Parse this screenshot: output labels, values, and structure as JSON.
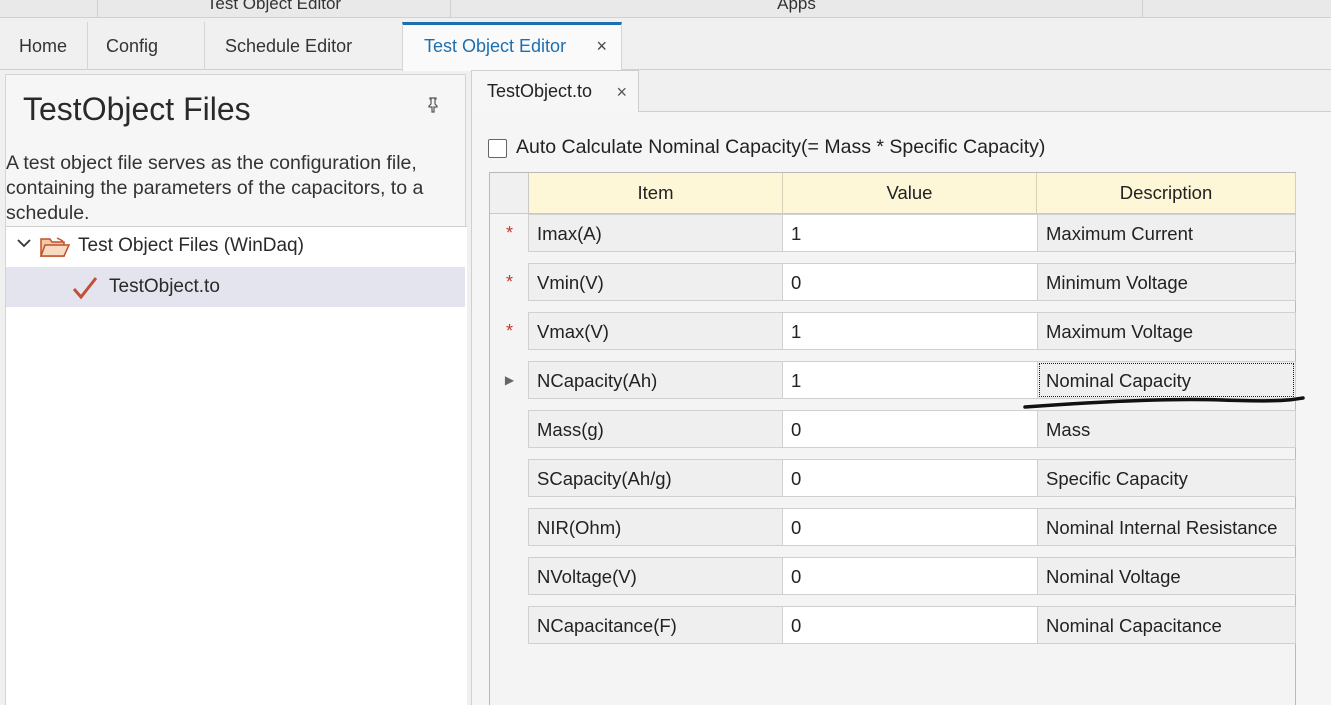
{
  "ribbon_groups": [
    "Test Object Editor",
    "Apps"
  ],
  "tabs": [
    {
      "label": "Home"
    },
    {
      "label": "Config"
    },
    {
      "label": "Schedule Editor"
    },
    {
      "label": "Test Object Editor",
      "close": "×"
    }
  ],
  "left_panel": {
    "title": "TestObject Files",
    "pin_icon": "📌",
    "description_lines": [
      "A test object file serves as the configuration file,",
      "containing the parameters of the capacitors, to a",
      "schedule."
    ],
    "tree": {
      "root_label": "Test Object Files (WinDaq)",
      "child_label": "TestObject.to"
    }
  },
  "doc_tab": {
    "label": "TestObject.to",
    "close": "×"
  },
  "auto_calc": {
    "label": "Auto Calculate Nominal Capacity(= Mass * Specific Capacity)",
    "checked": false
  },
  "grid": {
    "headers": [
      "Item",
      "Value",
      "Description"
    ],
    "rows": [
      {
        "indicator": "*",
        "item": "Imax(A)",
        "value": "1",
        "description": "Maximum Current"
      },
      {
        "indicator": "*",
        "item": "Vmin(V)",
        "value": "0",
        "description": "Minimum Voltage"
      },
      {
        "indicator": "*",
        "item": "Vmax(V)",
        "value": "1",
        "description": "Maximum Voltage"
      },
      {
        "indicator": "▶",
        "item": "NCapacity(Ah)",
        "value": "1",
        "description": "Nominal Capacity"
      },
      {
        "indicator": "",
        "item": "Mass(g)",
        "value": "0",
        "description": "Mass"
      },
      {
        "indicator": "",
        "item": "SCapacity(Ah/g)",
        "value": "0",
        "description": "Specific Capacity"
      },
      {
        "indicator": "",
        "item": "NIR(Ohm)",
        "value": "0",
        "description": "Nominal Internal Resistance"
      },
      {
        "indicator": "",
        "item": "NVoltage(V)",
        "value": "0",
        "description": "Nominal Voltage"
      },
      {
        "indicator": "",
        "item": "NCapacitance(F)",
        "value": "0",
        "description": "Nominal Capacitance"
      }
    ]
  },
  "colors": {
    "accent": "#1e6fb0",
    "header_bg": "#fdf7d8",
    "required_star": "#c0392b",
    "selected_tree": "#e4e4ee"
  }
}
